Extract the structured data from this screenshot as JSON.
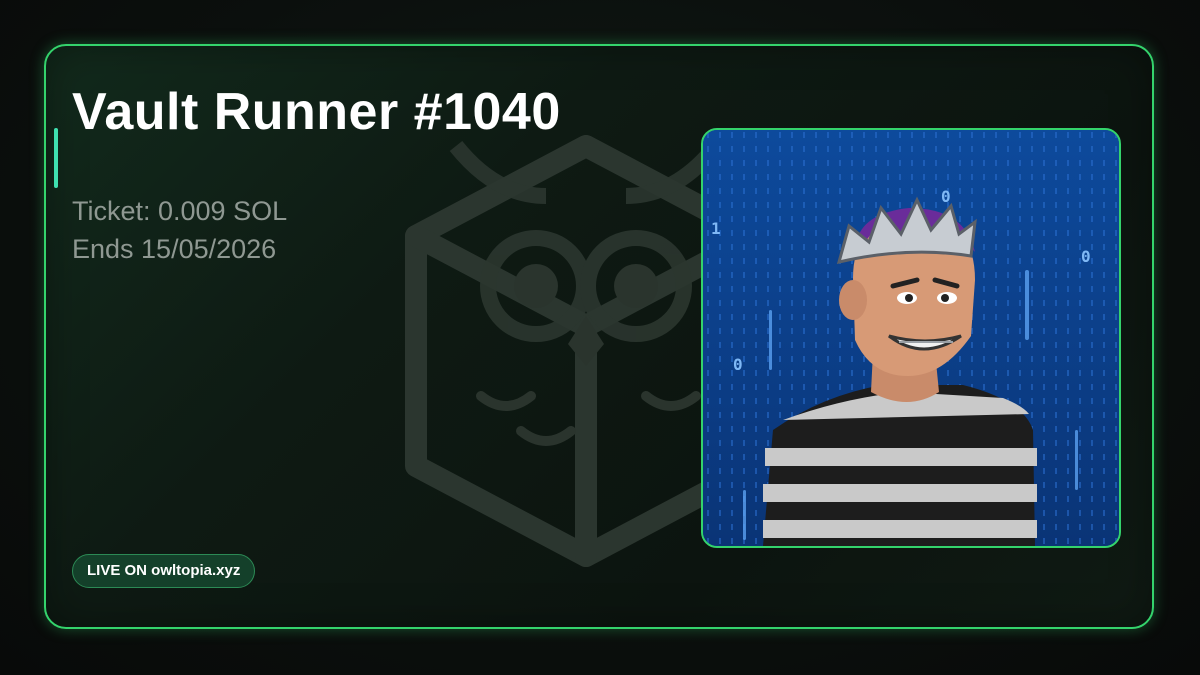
{
  "card": {
    "title": "Vault Runner #1040",
    "ticket_label": "Ticket: 0.009 SOL",
    "ends_label": "Ends 15/05/2026",
    "badge_label": "LIVE ON owltopia.xyz"
  },
  "artwork": {
    "subject": "character-portrait-crowned-thief",
    "background": "digital-rain",
    "glyphs": [
      "0",
      "1",
      "0",
      "0",
      "1",
      "0",
      "1",
      "0"
    ]
  },
  "colors": {
    "accent": "#34d36c",
    "accent_bar": "#3fe0b0",
    "title": "#ffffff",
    "muted_text": "#8f9892",
    "badge_bg": "#14402a",
    "art_bg": "#0a3f86"
  },
  "icons": {
    "watermark": "owl-box-logo-icon"
  }
}
